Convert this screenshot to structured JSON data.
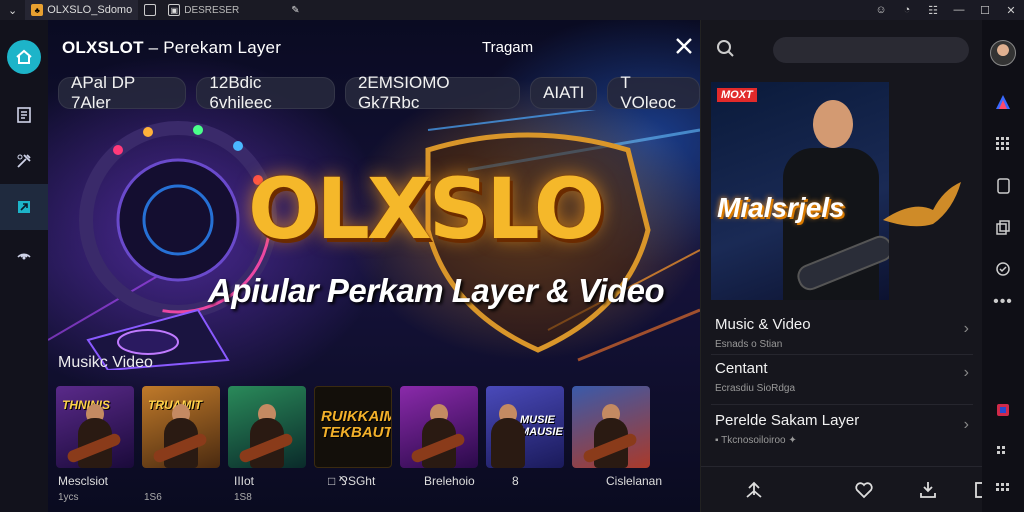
{
  "titlebar": {
    "tabs": [
      {
        "label": "OLXSLO_Sdomo",
        "icon": "game-icon"
      },
      {
        "label": "",
        "icon": "page-icon"
      },
      {
        "label": "DESRESER",
        "icon": "browser-icon"
      },
      {
        "label": "",
        "icon": "cursor-icon"
      }
    ],
    "controls": [
      "face-icon",
      "timer-icon",
      "chat-icon",
      "minimize",
      "restore",
      "close"
    ]
  },
  "leftrail": {
    "items": [
      "home-icon",
      "document-icon",
      "tools-icon",
      "plugin-icon",
      "signal-icon"
    ]
  },
  "main": {
    "title": "OLXSLOT",
    "title_sub": " – Perekam Layer",
    "top_center": "Tragam",
    "chips": [
      "APal DP 7Aler",
      "12Bdic 6vhileec",
      "2EMSIOMO Gk7Rbc",
      "AIATI",
      "T VOleoc"
    ],
    "hero_logo": "OLXSLO",
    "hero_tagline": "Apiular Perkam Layer & Video",
    "section_title": "Musikc Video",
    "thumbnails": [
      {
        "title_art": "THNINIS",
        "label": "Mesclsiot",
        "meta": "1ycs",
        "bg": "#3a1a55"
      },
      {
        "title_art": "TRUAMIT",
        "label": "",
        "meta": "1S6",
        "bg": "#7a4a18"
      },
      {
        "title_art": "",
        "label": "IIIot",
        "meta": "1S8",
        "bg": "#1a4a3a"
      },
      {
        "title_art": "RUIKKAIM TEKBAUT",
        "label": "□ ⅋SGht",
        "meta": "",
        "bg": "#130f0a"
      },
      {
        "title_art": "",
        "label": "Brelehoio",
        "meta": "",
        "bg": "#4a1a6a"
      },
      {
        "title_art": "MUSIE MAUSIE",
        "label": "8",
        "meta": "",
        "bg": "#2a2a7a"
      },
      {
        "title_art": "",
        "label": "Cislelanan",
        "meta": "",
        "bg": "#2a3a6a"
      }
    ]
  },
  "rpanel": {
    "search_placeholder": "",
    "feature": {
      "badge": "MOXT",
      "word": "Mialsrjels"
    },
    "list": [
      {
        "title": "Music & Video",
        "sub": "Esnads o Stian"
      },
      {
        "title": "Centant",
        "sub": "Ecrasdiu SioRdga"
      },
      {
        "title": "Perelde Sakam Layer",
        "sub": "▪ Tkcnosoiloiroo ✦"
      }
    ],
    "bottom_icons": [
      "share-icon",
      "heart-icon",
      "download-icon",
      "window-icon"
    ]
  },
  "farrail": {
    "icons": [
      "avatar",
      "brand-icon",
      "grid-icon",
      "tablet-icon",
      "copy-icon",
      "badge-icon",
      "more-icon",
      "flag-icon",
      "grid-small-icon",
      "grid-icon"
    ]
  },
  "colors": {
    "accent": "#1db4c9",
    "logo_gold": "#f5b82a",
    "panel_bg": "#16161d"
  }
}
